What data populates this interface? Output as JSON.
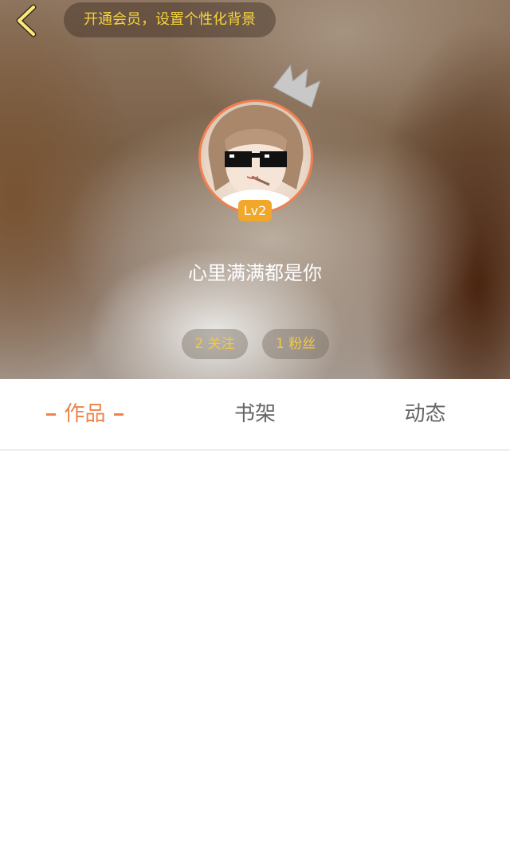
{
  "header": {
    "vip_banner_text": "开通会员，设置个性化背景",
    "level_badge": "Lv2",
    "nickname": "心里满满都是你",
    "stats": {
      "following": "2 关注",
      "followers": "1 粉丝"
    }
  },
  "tabs": {
    "works": "作品",
    "bookshelf": "书架",
    "activity": "动态",
    "active": "works"
  },
  "icons": {
    "back": "chevron-left-icon",
    "crown": "crown-icon"
  },
  "colors": {
    "accent": "#f0824a",
    "vip_text": "#f5d33a",
    "stat_text": "#f5c842",
    "level_badge": "#f0a72a",
    "avatar_border": "#f08050"
  }
}
